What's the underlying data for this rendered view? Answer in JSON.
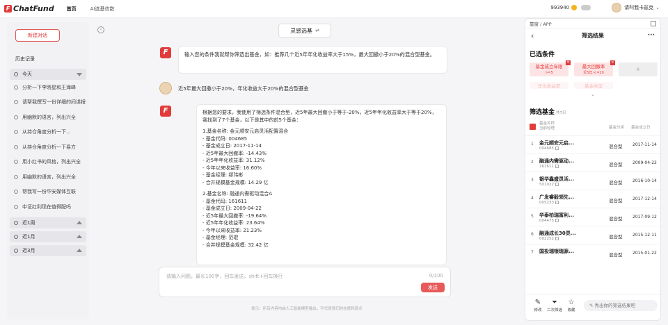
{
  "topbar": {
    "logo": "ChatFund",
    "nav": [
      "首页",
      "AI选基信数"
    ],
    "balance": "993940",
    "username": "请叫我卡兹克"
  },
  "sidebar": {
    "new_chat": "新建对话",
    "history_title": "历史记录",
    "today": "今天",
    "items": [
      "分析一下李晓星和王海峰",
      "请帮我撰写一份详细的间谍报告",
      "用幽默的语言，列出兴全",
      "从持仓角度分析一下...",
      "从持仓角度分析一下易方",
      "用小红书的风格，列出兴全",
      "用幽默的语言，列出兴全",
      "帮我写一份华安媒体互联",
      "中证红利现在值得配吗"
    ],
    "groups": [
      "近1周",
      "近1月",
      "近3月"
    ]
  },
  "main": {
    "mode_button": "灵感选基",
    "mode_switch": "⇌",
    "prompt_bubble": "输入您的条件我就帮你筛选出基金，如：推荐几个近5年年化收益率大于15%，最大回撤小于20%的混合型基金。",
    "user_message": "近5年最大回撤小于20%，年化收益大于20%的混合型基金",
    "answer_lines": [
      "根据您的要求，我使用了筛选条件混合型，近5年最大回撤小于等于-20%，近5年年化收益率大于等于20%，",
      "我找到了7个基金，以下是其中的前5个基金：",
      "",
      "1.基金名称: 金元顺安元启灵活配置混合",
      "  - 基金代码: 004685",
      "  - 基金成立日: 2017-11-14",
      "  - 近5年最大回撤率: -14.43%",
      "  - 近5年年化收益率: 31.12%",
      "  - 今年以来收益率: 16.60%",
      "  - 基金经理: 缪玮彬",
      "  - 合并规模基金规模: 14.29 亿",
      "",
      "2.基金名称: 融通内需驱动混合A",
      "  - 基金代码: 161611",
      "  - 基金成立日: 2009-04-22",
      "  - 近5年最大回撤率: -19.64%",
      "  - 近5年年化收益率: 23.64%",
      "  - 今年以来收益率: 21.23%",
      "  - 基金经理: 范琨",
      "  - 合并规模基金规模: 32.42 亿"
    ],
    "input_placeholder": "请输入问题，最长100字，回车发送，shift+回车换行",
    "input_count": "0/100",
    "send_label": "发送",
    "disclaimer": "提示：所有内容均由人工智能模型输出，不代表我们的态度和观点"
  },
  "panel": {
    "header": "靠窗 / APP",
    "title": "筛选结果",
    "selected_title": "已选条件",
    "chips": [
      {
        "label": "基金成立年限",
        "sub": ">=5"
      },
      {
        "label": "最大回撤率",
        "sub": "近5年:<=20"
      },
      {
        "label": "+",
        "sub": ""
      },
      {
        "label": "年化收益率",
        "sub": ""
      },
      {
        "label": "基金类型",
        "sub": ""
      }
    ],
    "list_title": "筛选基金",
    "list_count": "共7只",
    "col_name": "基金名称",
    "col_manager": "当前经理",
    "col_type": "基金分类",
    "col_date": "基金成立日",
    "rows": [
      {
        "idx": "1",
        "name": "金元顺安元启...",
        "code": "004685",
        "type": "混合型",
        "date": "2017-11-14"
      },
      {
        "idx": "2",
        "name": "融通内需驱动...",
        "code": "161611",
        "type": "混合型",
        "date": "2009-04-22"
      },
      {
        "idx": "3",
        "name": "银华鑫盛灵活...",
        "code": "501022",
        "type": "混合型",
        "date": "2016-10-14"
      },
      {
        "idx": "4",
        "name": "广发睿毅领先...",
        "code": "005233",
        "type": "混合型",
        "date": "2017-12-14"
      },
      {
        "idx": "5",
        "name": "华泰柏瑞富利...",
        "code": "004475",
        "type": "混合型",
        "date": "2017-09-12"
      },
      {
        "idx": "6",
        "name": "融通成长30灵...",
        "code": "002252",
        "type": "混合型",
        "date": "2015-12-11"
      },
      {
        "idx": "7",
        "name": "国投瑞银瑞源...",
        "code": "",
        "type": "混合型",
        "date": "2015-01-22"
      }
    ],
    "foot": {
      "edit": "修改",
      "filter": "二次筛选",
      "fav": "收藏",
      "share": "秀出你的筛选结果吧"
    }
  }
}
